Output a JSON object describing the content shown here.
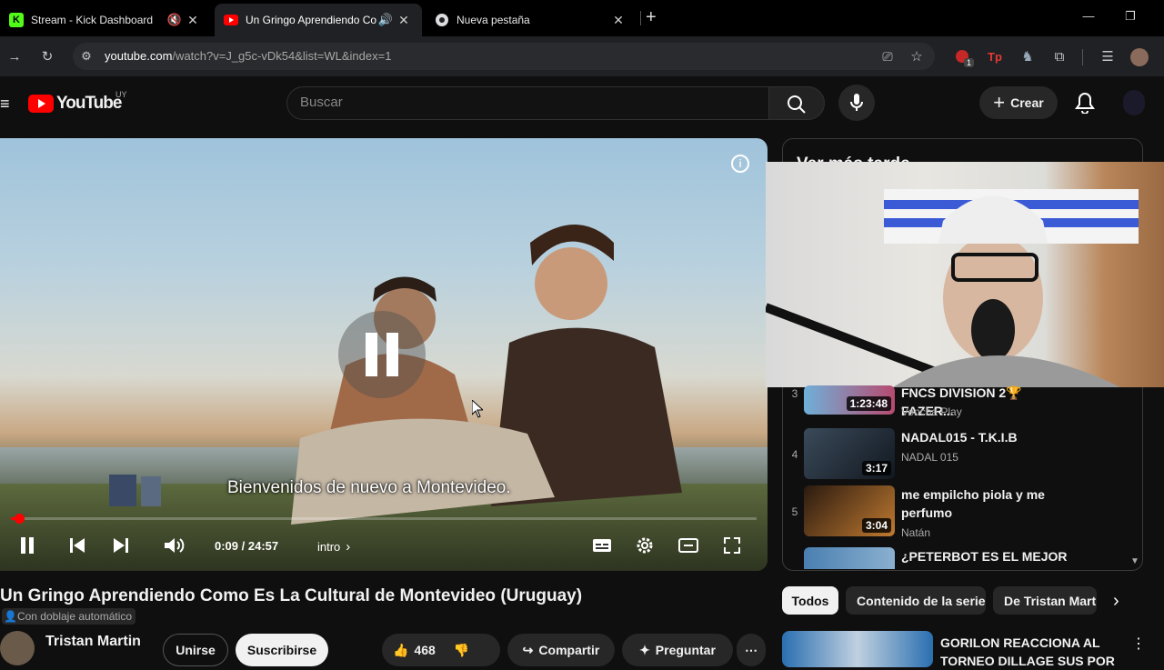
{
  "browser": {
    "tabs": [
      {
        "title": "Stream - Kick Dashboard",
        "favicon": "K"
      },
      {
        "title": "Un Gringo Aprendiendo Co"
      },
      {
        "title": "Nueva pestaña"
      }
    ],
    "url_host": "youtube.com",
    "url_path": "/watch?v=J_g5c-vDk54&list=WL&index=1",
    "extension_badge": "1"
  },
  "youtube": {
    "logo_text": "YouTube",
    "country_code": "UY",
    "search_placeholder": "Buscar",
    "create_label": "Crear"
  },
  "player": {
    "subtitle": "Bienvenidos de nuevo a Montevideo.",
    "time": "0:09 / 24:57",
    "chapter": "intro",
    "progress_fraction": 0.006
  },
  "video": {
    "title": "Un Gringo Aprendiendo Como Es La Cultural de Montevideo (Uruguay)",
    "dubbing": "Con doblaje automático",
    "channel": "Tristan Martin",
    "join_label": "Unirse",
    "subscribe_label": "Suscribirse",
    "likes": "468",
    "share_label": "Compartir",
    "ask_label": "Preguntar"
  },
  "sidebar": {
    "header": "Ver más tarde",
    "items": [
      {
        "index": "3",
        "title": "FNCS DIVISION 2🏆FAZER...",
        "channel": "Vencha Play",
        "duration": "1:23:48"
      },
      {
        "index": "4",
        "title": "NADAL015 - T.K.I.B",
        "channel": "NADAL 015",
        "duration": "3:17"
      },
      {
        "index": "5",
        "title": "me empilcho piola y me perfumo",
        "channel": "Natán",
        "duration": "3:04"
      },
      {
        "index": "",
        "title": "¿PETERBOT ES EL MEJOR DE LA HISTORIA ACTUALMENTE",
        "channel": "",
        "duration": ""
      }
    ]
  },
  "chips": [
    "Todos",
    "Contenido de la serie",
    "De Tristan Martin"
  ],
  "recommendation": {
    "title": "GORILON REACCIONA AL TORNEO DILLAGE SUS POR"
  },
  "colors": {
    "accent": "#ff0000",
    "background": "#0f0f0f"
  }
}
